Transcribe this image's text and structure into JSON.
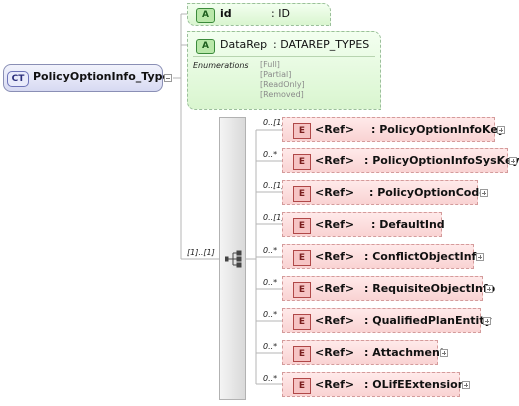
{
  "root": {
    "badge": "CT",
    "name": "PolicyOptionInfo_Type"
  },
  "attributes": [
    {
      "badge": "A",
      "name": "id",
      "type": ": ID"
    },
    {
      "badge": "A",
      "name": "DataRep",
      "type": ": DATAREP_TYPES",
      "enumerations_label": "Enumerations",
      "enumerations": [
        "[Full]",
        "[Partial]",
        "[ReadOnly]",
        "[Removed]"
      ]
    }
  ],
  "sequence": {
    "cardinality": "[1]..[1]"
  },
  "elements": [
    {
      "badge": "E",
      "ref": "<Ref>",
      "type": ": PolicyOptionInfoKey",
      "cardinality": "0..[1]"
    },
    {
      "badge": "E",
      "ref": "<Ref>",
      "type": ": PolicyOptionInfoSysKey",
      "cardinality": "0..*"
    },
    {
      "badge": "E",
      "ref": "<Ref>",
      "type": ": PolicyOptionCode",
      "cardinality": "0..[1]"
    },
    {
      "badge": "E",
      "ref": "<Ref>",
      "type": ": DefaultInd",
      "cardinality": "0..[1]"
    },
    {
      "badge": "E",
      "ref": "<Ref>",
      "type": ": ConflictObjectInfo",
      "cardinality": "0..*"
    },
    {
      "badge": "E",
      "ref": "<Ref>",
      "type": ": RequisiteObjectInfo",
      "cardinality": "0..*"
    },
    {
      "badge": "E",
      "ref": "<Ref>",
      "type": ": QualifiedPlanEntity",
      "cardinality": "0..*"
    },
    {
      "badge": "E",
      "ref": "<Ref>",
      "type": ": Attachment",
      "cardinality": "0..*"
    },
    {
      "badge": "E",
      "ref": "<Ref>",
      "type": ": OLifEExtension",
      "cardinality": "0..*"
    }
  ]
}
